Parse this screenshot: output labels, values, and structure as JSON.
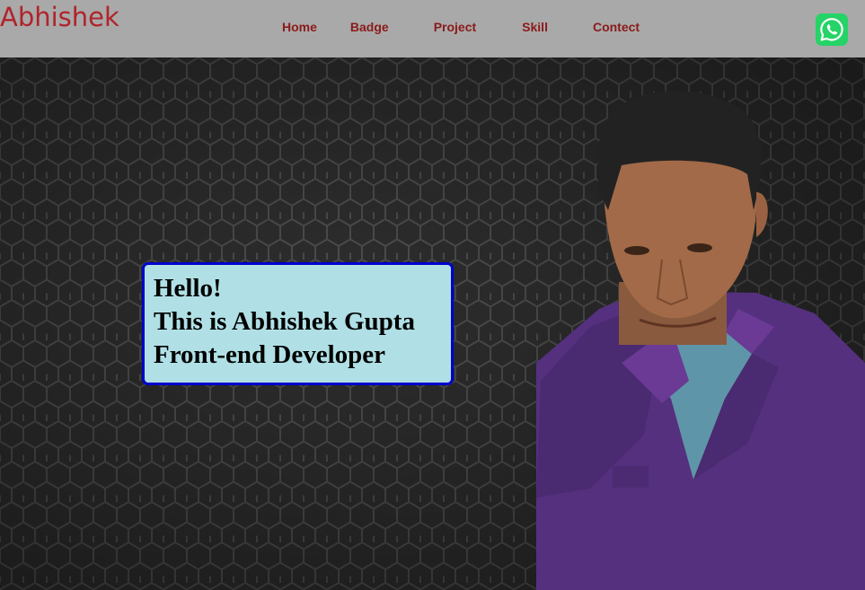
{
  "header": {
    "logo": "Abhishek",
    "nav": [
      {
        "label": "Home"
      },
      {
        "label": "Badge"
      },
      {
        "label": "Project"
      },
      {
        "label": "Skill"
      },
      {
        "label": "Contect"
      }
    ],
    "whatsapp_icon": "whatsapp-icon",
    "colors": {
      "header_bg": "#a9a9a9",
      "logo": "#b0242b",
      "nav_text": "#8b1a1a",
      "whatsapp": "#25d366"
    }
  },
  "hero": {
    "background_pattern": "dark-hexagon-grid",
    "intro": {
      "greeting": "Hello!",
      "name_line": "This is Abhishek Gupta",
      "role_line": "Front-end Developer",
      "box_color": "#b0e0e6",
      "border_color": "#0000cc"
    },
    "portrait": "profile-photo"
  }
}
